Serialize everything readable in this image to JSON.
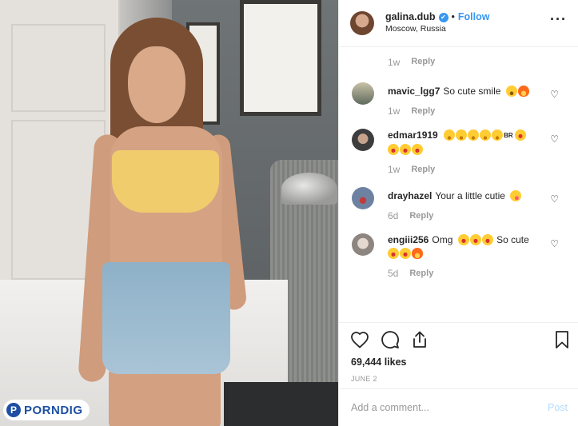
{
  "post": {
    "username": "galina.dub",
    "location": "Moscow, Russia",
    "follow_label": "Follow",
    "separator": "•",
    "first_meta": {
      "time": "1w",
      "reply": "Reply"
    }
  },
  "comments": [
    {
      "user": "mavic_lgg7",
      "text": "So cute smile",
      "emojis": [
        "smile",
        "fire"
      ],
      "time": "1w",
      "reply": "Reply",
      "avatar_color": "#8a9a8f"
    },
    {
      "user": "edmar1919",
      "text": "",
      "emojis": [
        "hug",
        "hug",
        "hug",
        "hug",
        "hug"
      ],
      "badge": "BR",
      "emojis2": [
        "heart",
        "heart",
        "heart",
        "heart"
      ],
      "time": "1w",
      "reply": "Reply",
      "avatar_color": "#4a4a4a"
    },
    {
      "user": "drayhazel",
      "text": "Your a little cutie",
      "emojis": [
        "yum"
      ],
      "time": "6d",
      "reply": "Reply",
      "avatar_color": "#5a6d86"
    },
    {
      "user": "engiii256",
      "text": "Omg",
      "emojis": [
        "heart",
        "heart",
        "heart"
      ],
      "text2": "So cute",
      "emojis2": [
        "heart",
        "heart",
        "fire"
      ],
      "time": "5d",
      "reply": "Reply",
      "avatar_color": "#b9b2ad"
    }
  ],
  "engagement": {
    "likes": "69,444 likes",
    "date": "JUNE 2"
  },
  "composer": {
    "placeholder": "Add a comment...",
    "post_label": "Post"
  },
  "watermark": {
    "logo": "P",
    "text": "PORNDIG"
  },
  "icons": {
    "more": "more-icon",
    "heart": "heart-icon",
    "comment": "comment-icon",
    "share": "share-icon",
    "bookmark": "bookmark-icon",
    "verified": "verified-badge-icon"
  },
  "colors": {
    "accent": "#3897f0",
    "muted": "#999999",
    "post_disabled": "#b3dbff"
  }
}
